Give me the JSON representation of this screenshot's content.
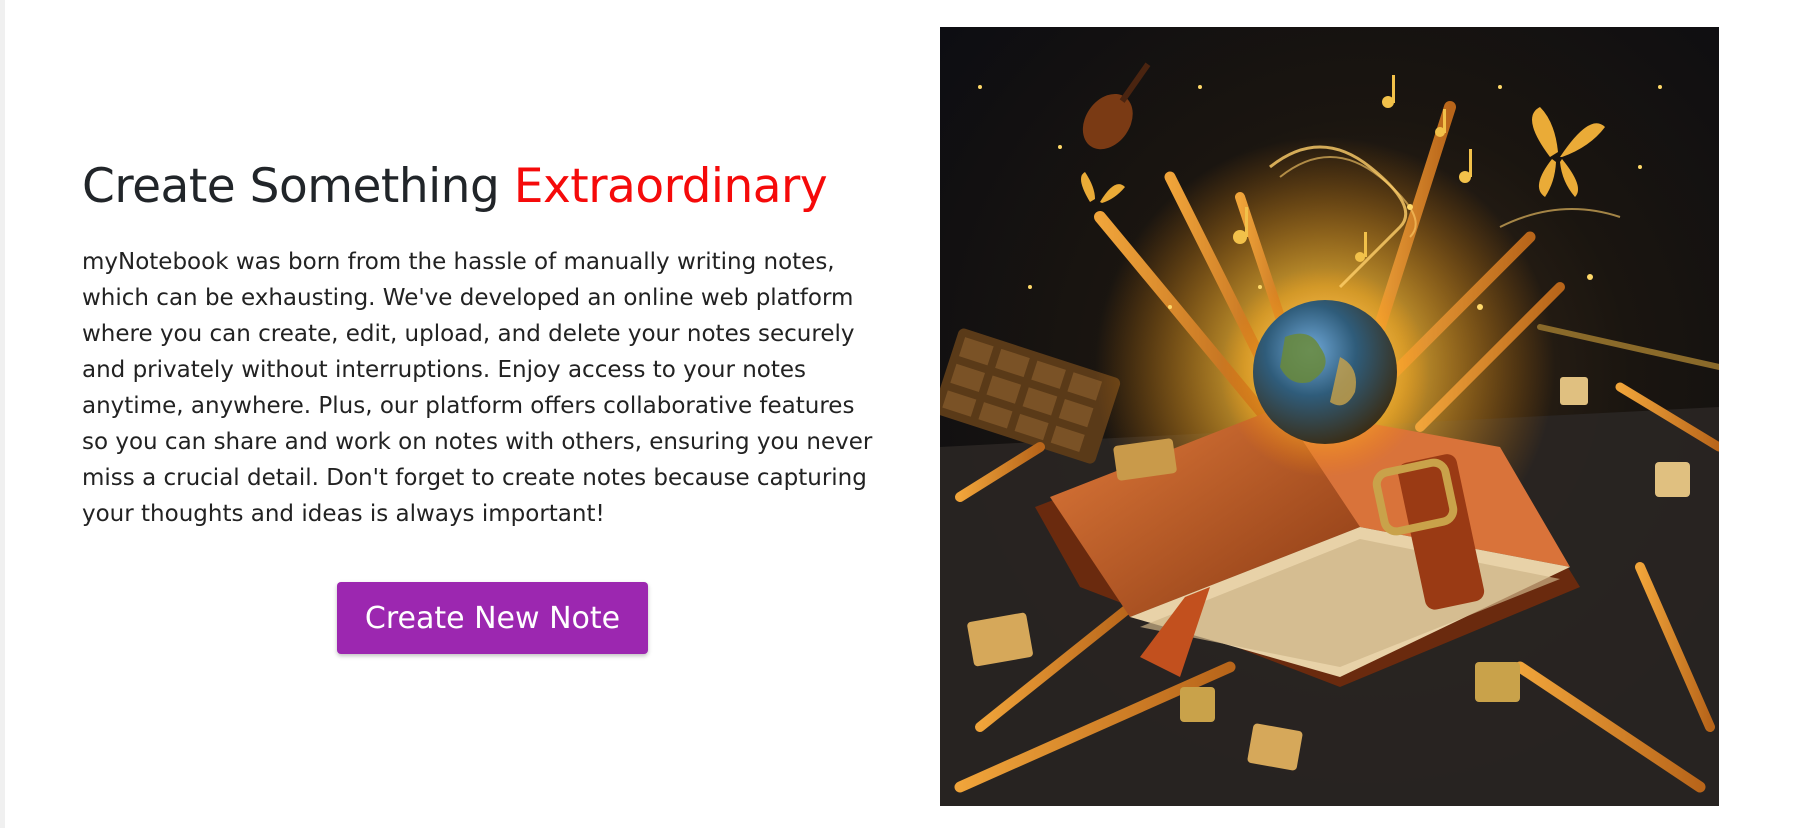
{
  "hero": {
    "title_main": "Create Something",
    "title_accent": "Extraordinary",
    "description_lines": [
      "myNotebook was born from the hassle of manually writing notes,",
      "which can be exhausting. We've developed an online web platform",
      "where you can create, edit, upload, and delete your notes securely",
      "and privately without interruptions. Enjoy access to your notes",
      "anytime, anywhere. Plus, our platform offers collaborative features",
      "so you can share and work on notes with others, ensuring you never",
      "miss a crucial detail. Don't forget to create notes because capturing",
      "your thoughts and ideas is always important!"
    ],
    "cta_label": "Create New Note"
  },
  "colors": {
    "accent": "#f50a0a",
    "button": "#9c27b0",
    "text": "#212529"
  }
}
